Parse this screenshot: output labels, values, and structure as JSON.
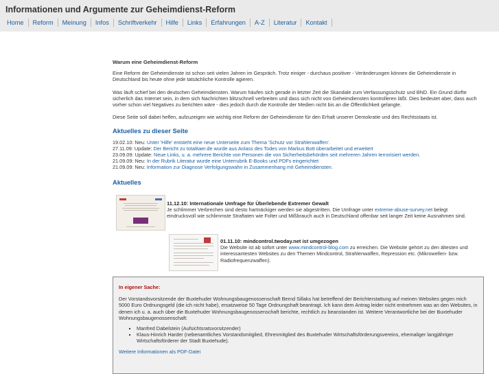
{
  "site": {
    "title": "Informationen und Argumente zur Geheimdienst-Reform"
  },
  "nav": [
    "Home",
    "Reform",
    "Meinung",
    "Infos",
    "Schriftverkehr",
    "Hilfe",
    "Links",
    "Erfahrungen",
    "A-Z",
    "Literatur",
    "Kontakt"
  ],
  "intro": {
    "heading": "Warum eine Geheimdienst-Reform",
    "p1": "Eine Reform der Geheimdienste ist schon seit vielen Jahren im Gespräch. Trotz einiger - durchaus positiver - Veränderungen können die Geheimdienste in Deutschland bis heute ohne jede tatsächliche Kontrolle agieren.",
    "p2": "Was läuft schief bei den deutschen Geheimdiensten. Warum häufen sich gerade in letzter Zeit die Skandale zum Verfassungsschutz und BND. Ein Grund dürfte sicherlich das Internet sein, in dem sich Nachrichten blitzschnell verbreiten und dass sich nicht von Geheimdiensten kontrolleren läßt. Dies bedeutet aber, dass auch vorher schon viel Negatives zu berichten wäre - dies jedoch durch die Kontrolle der Medien nicht bis an die Öffentlichkeit gelangte.",
    "p3": "Diese Seite soll dabei helfen, aufzuzeigen wie wichtig eine Reform der Geheimdienste für den Erhalt unserer Demokratie und des Rechtsstaats ist."
  },
  "updates": {
    "heading": "Aktuelles zu dieser Seite",
    "items": [
      {
        "prefix": "19.02.10: Neu:",
        "link": "Unter 'Hilfe' entsteht eine neue Unterseite zum Thema 'Schutz vor Strahlenwaffen'."
      },
      {
        "prefix": "27.11.09: Update:",
        "link": "Der Bericht zu totalitaer.de wurde aus Anlass des Todes von Markus Bott überarbeitet und erweitert"
      },
      {
        "prefix": "23.09.09: Update:",
        "link": "Neue Links, u. a. mehrere Berichte von Personen die von Sicherheitsbehörden seit mehreren Jahren terrorisiert werden."
      },
      {
        "prefix": "21.09.09: Neu:",
        "link": "In der Rubrik Literatur wurde eine Unterrubrik E-Books und PDFs eingerichtet"
      },
      {
        "prefix": "21.09.09: Neu:",
        "link": "Information zur Diagnose Verfolgungswahn in Zusammenhang mit Geheimdiensten."
      }
    ]
  },
  "news": {
    "heading": "Aktuelles",
    "item1": {
      "title": "11.12.10: Internationale Umfrage für Überlebende Extremer Gewalt",
      "text_before": "Je schlimmer Verbrechen sind desto hartnäckiger werden sie abgestritten. Die Umfrage unter",
      "link": "extreme-abuse-survey.net",
      "text_after": "belegt eindrucksvoll wie schlimmste Straftaten wie Folter und Mißbrauch auch in Deutschland offenbar seit langer Zeit keine Ausnahmen sind."
    },
    "item2": {
      "title": "01.11.10: mindcontrol.twoday.net ist umgezogen",
      "text_before": "Die Website ist ab sofort unter",
      "link": "www.mindcontrol-blog.com",
      "text_after": "zu erreichen. Die Website gehört zu den ältesten und interessantesten Websites zu den Themen Mindcontrol, Strahlenwaffen, Repression etc. (Mikrowellen- bzw. Radiofrequenzwaffen)."
    }
  },
  "notice": {
    "title": "In eigener Sache:",
    "text": "Der Vorstandsvorsitzende der Buxtehuder Wohnungsbaugenossenschaft Bernd Sillaks hat betreffend der Berichterstattung auf meinen Websites gegen mich 5000 Euro Ordnungsgeld (die ich nicht habe), ersatzweise 50 Tage Ordnungshaft beantragt. Ich kann dem Antrag leider nicht entnehmen was an den Websites, in denen ich u. a. auch über die Buxtehuder Wohnungsbaugenossenschaft berichte, rechtlich zu beanstanden ist. Weitere Verantwortliche bei der Buxtehuder Wohnungsbaugenossenschaft:",
    "list": [
      "Manfred Dabelstein (Aufsichtsratsvorsitzender)",
      "Klaus-Hinrich Harder (nebenamtliches Vorstandsmitglied, Ehrenmitglied des Buxtehuder Wirtschaftsförderungsvereins, ehemaliger langjähriger Wirtschaftsförderer der Stadt Buxtehude)."
    ],
    "link": "Weitere Informationen als PDF-Datei"
  },
  "colors": {
    "link": "#1a5fa0",
    "topbar": "#eaeaea",
    "notice_title": "#b01010"
  }
}
